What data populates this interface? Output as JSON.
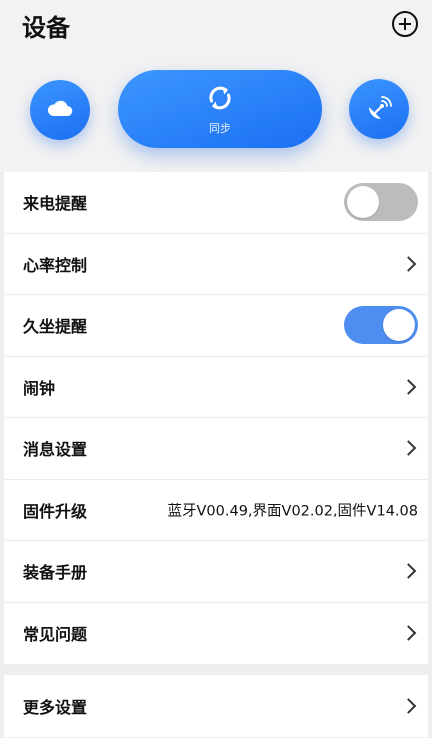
{
  "header": {
    "title": "设备",
    "add_icon": "plus-circle-icon"
  },
  "quick_actions": {
    "cloud_icon": "cloud-icon",
    "sync_label": "同步",
    "sync_icon": "sync-icon",
    "satellite_icon": "satellite-icon"
  },
  "settings": {
    "incoming_call": {
      "label": "来电提醒",
      "enabled": false
    },
    "heart_rate": {
      "label": "心率控制"
    },
    "sedentary": {
      "label": "久坐提醒",
      "enabled": true
    },
    "alarm": {
      "label": "闹钟"
    },
    "messages": {
      "label": "消息设置"
    },
    "firmware": {
      "label": "固件升级",
      "value": "蓝牙V00.49,界面V02.02,固件V14.08"
    },
    "manual": {
      "label": "装备手册"
    },
    "faq": {
      "label": "常见问题"
    },
    "more": {
      "label": "更多设置"
    }
  },
  "colors": {
    "accent": "#1f78f5",
    "toggle_on": "#4e8ef0",
    "toggle_off": "#bcbcbc",
    "background": "#eeeeee"
  }
}
